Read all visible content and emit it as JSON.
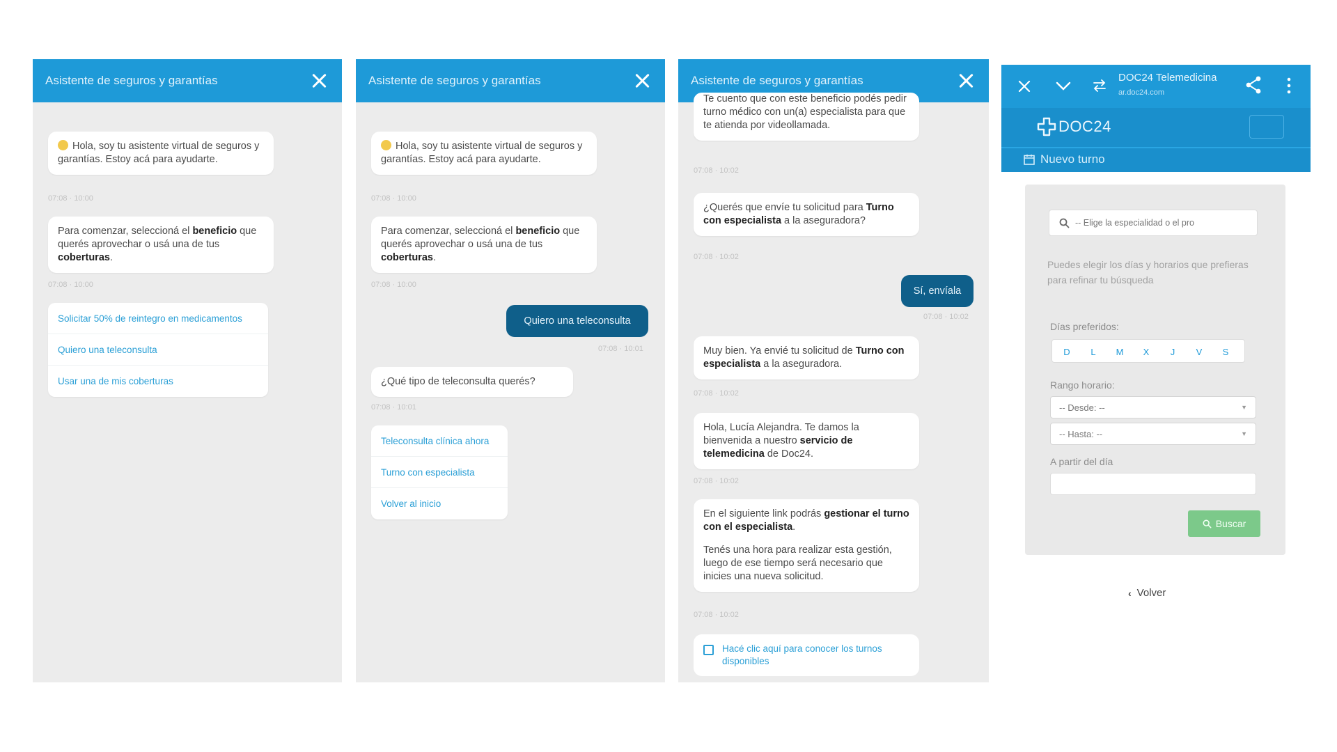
{
  "panel1": {
    "header": "Asistente de seguros y garantías",
    "greeting": "Hola, soy tu asistente virtual de seguros y garantías. Estoy acá para ayudarte.",
    "greeting_time": "07:08 · 10:00",
    "intro_pre": "Para comenzar, seleccioná el ",
    "intro_b1": "beneficio",
    "intro_mid": " que querés aprovechar o usá una de tus ",
    "intro_b2": "coberturas",
    "intro_post": ".",
    "intro_time": "07:08 · 10:00",
    "options": [
      "Solicitar 50% de reintegro en medicamentos",
      "Quiero una teleconsulta",
      "Usar una de mis coberturas"
    ]
  },
  "panel2": {
    "header": "Asistente de seguros y garantías",
    "greeting": "Hola, soy tu asistente virtual de seguros y garantías. Estoy acá para ayudarte.",
    "greeting_time": "07:08 · 10:00",
    "intro_pre": "Para comenzar, seleccioná el ",
    "intro_b1": "beneficio",
    "intro_mid": " que querés aprovechar o usá una de tus ",
    "intro_b2": "coberturas",
    "intro_post": ".",
    "intro_time": "07:08 · 10:00",
    "user_msg": "Quiero una teleconsulta",
    "user_time": "07:08 · 10:01",
    "question": "¿Qué tipo de teleconsulta querés?",
    "question_time": "07:08 · 10:01",
    "options": [
      "Teleconsulta clínica ahora",
      "Turno con especialista",
      "Volver al inicio"
    ]
  },
  "panel3": {
    "header": "Asistente de seguros y garantías",
    "top_msg": "Te cuento que con este beneficio podés pedir turno médico con un(a) especialista para que te atienda por videollamada.",
    "top_time": "07:08 · 10:02",
    "q_pre": "¿Querés que envíe tu solicitud para ",
    "q_b": "Turno con especialista",
    "q_post": " a la aseguradora?",
    "q_time": "07:08 · 10:02",
    "user_msg": "Sí, envíala",
    "user_time": "07:08 · 10:02",
    "ok_pre": "Muy bien. Ya envié tu solicitud de ",
    "ok_b": "Turno con especialista",
    "ok_post": " a la aseguradora.",
    "ok_time": "07:08 · 10:02",
    "welcome_pre": "Hola, Lucía Alejandra. Te damos la bienvenida a nuestro ",
    "welcome_b": "servicio de telemedicina",
    "welcome_post": " de Doc24.",
    "welcome_time": "07:08 · 10:02",
    "link_p1_pre": "En el siguiente link podrás ",
    "link_p1_b": "gestionar el turno con el especialista",
    "link_p1_post": ".",
    "link_p2": "Tenés una hora para realizar esta gestión, luego de ese tiempo será necesario que inicies una nueva solicitud.",
    "link_time": "07:08 · 10:02",
    "link_card": "Hacé clic aquí para conocer los turnos disponibles"
  },
  "panel4": {
    "app_title": "DOC24 Telemedicina",
    "app_url": "ar.doc24.com",
    "logo": "DOC24",
    "nav_tab": "Nuevo turno",
    "search_placeholder": "-- Elige la especialidad o el pro",
    "help_text": "Puedes elegir los días y horarios que prefieras para refinar tu búsqueda",
    "days_label": "Días preferidos:",
    "days": [
      "D",
      "L",
      "M",
      "X",
      "J",
      "V",
      "S"
    ],
    "range_label": "Rango horario:",
    "from": "-- Desde: --",
    "to": "-- Hasta: --",
    "date_label": "A partir del día",
    "date_value": "",
    "search_button": "Buscar",
    "back": "Volver"
  },
  "colors": {
    "header_blue": "#1e9ad8",
    "user_bubble": "#0f5f8a",
    "link_blue": "#2a9fd6",
    "search_green": "#7cc98a",
    "chat_bg": "#ececec"
  }
}
